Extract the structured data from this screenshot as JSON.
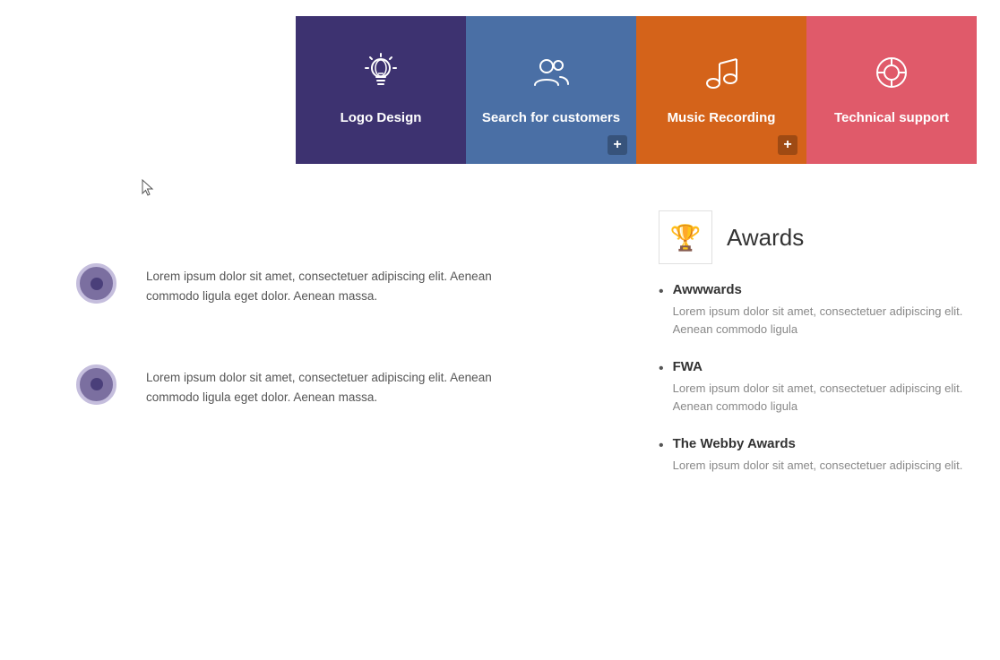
{
  "cards": [
    {
      "id": "logo-design",
      "label": "Logo Design",
      "icon": "💡",
      "bg": "#3d3270",
      "hasPlus": false
    },
    {
      "id": "search-customers",
      "label": "Search for customers",
      "icon": "👥",
      "bg": "#4a6fa5",
      "hasPlus": true
    },
    {
      "id": "music-recording",
      "label": "Music Recording",
      "icon": "🎵",
      "bg": "#d4631a",
      "hasPlus": true
    },
    {
      "id": "technical-support",
      "label": "Technical support",
      "icon": "🎯",
      "bg": "#e05a6a",
      "hasPlus": false
    }
  ],
  "awards": {
    "title": "Awards",
    "items": [
      {
        "name": "Awwwards",
        "description": "Lorem ipsum dolor sit amet, consectetuer adipiscing elit. Aenean commodo ligula"
      },
      {
        "name": "FWA",
        "description": "Lorem ipsum dolor sit amet, consectetuer adipiscing elit. Aenean commodo ligula"
      },
      {
        "name": "The Webby Awards",
        "description": "Lorem ipsum dolor sit amet, consectetuer adipiscing elit."
      }
    ]
  },
  "timeline": [
    {
      "text": "Lorem ipsum dolor sit amet, consectetuer adipiscing elit. Aenean commodo ligula eget dolor. Aenean massa."
    },
    {
      "text": "Lorem ipsum dolor sit amet, consectetuer adipiscing elit. Aenean commodo ligula eget dolor. Aenean massa."
    }
  ],
  "plus_label": "+"
}
